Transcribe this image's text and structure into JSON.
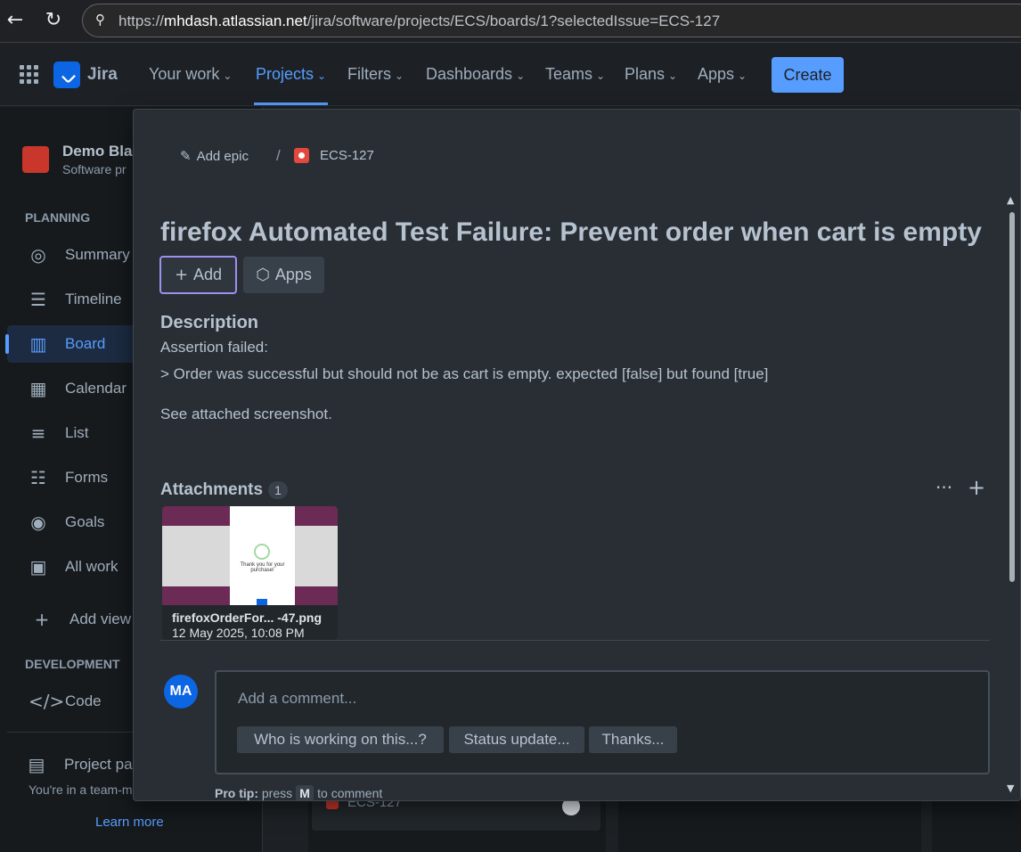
{
  "browser": {
    "url_prefix": "https://",
    "url_host": "mhdash.atlassian.net",
    "url_path": "/jira/software/projects/ECS/boards/1?selectedIssue=ECS-127"
  },
  "topnav": {
    "app_name": "Jira",
    "items": [
      "Your work",
      "Projects",
      "Filters",
      "Dashboards",
      "Teams",
      "Plans",
      "Apps"
    ],
    "create_label": "Create"
  },
  "sidebar": {
    "project_name": "Demo Bla",
    "project_sub": "Software pr",
    "planning_label": "PLANNING",
    "planning_items": [
      "Summary",
      "Timeline",
      "Board",
      "Calendar",
      "List",
      "Forms",
      "Goals",
      "All work"
    ],
    "add_view": "Add view",
    "development_label": "DEVELOPMENT",
    "code_label": "Code",
    "project_pages": "Project pa",
    "team_note": "You're in a team-m",
    "learn_more": "Learn more"
  },
  "board": {
    "card_key": "ECS-127"
  },
  "issue": {
    "add_epic": "Add epic",
    "separator": "/",
    "key": "ECS-127",
    "title": "firefox Automated Test Failure: Prevent order when cart is empty",
    "add_button": "Add",
    "apps_button": "Apps",
    "description_heading": "Description",
    "description_lines": [
      "Assertion failed:",
      "> Order was successful but should not be as cart is empty. expected [false] but found [true]",
      "See attached screenshot."
    ],
    "attachments_heading": "Attachments",
    "attachments_count": "1",
    "attachment": {
      "name": "firefoxOrderFor...  -47.png",
      "date": "12 May 2025, 10:08 PM",
      "thumb_text": "Thank you for your purchase!"
    },
    "avatar_initials": "MA",
    "comment_placeholder": "Add a comment...",
    "suggestions": [
      "Who is working on this...?",
      "Status update...",
      "Thanks..."
    ],
    "pro_tip_label": "Pro tip:",
    "pro_tip_pre": "press",
    "pro_tip_key": "M",
    "pro_tip_post": "to comment"
  },
  "colors": {
    "accent": "#579dff",
    "bug": "#e2483d",
    "avatar": "#0c66e4"
  }
}
